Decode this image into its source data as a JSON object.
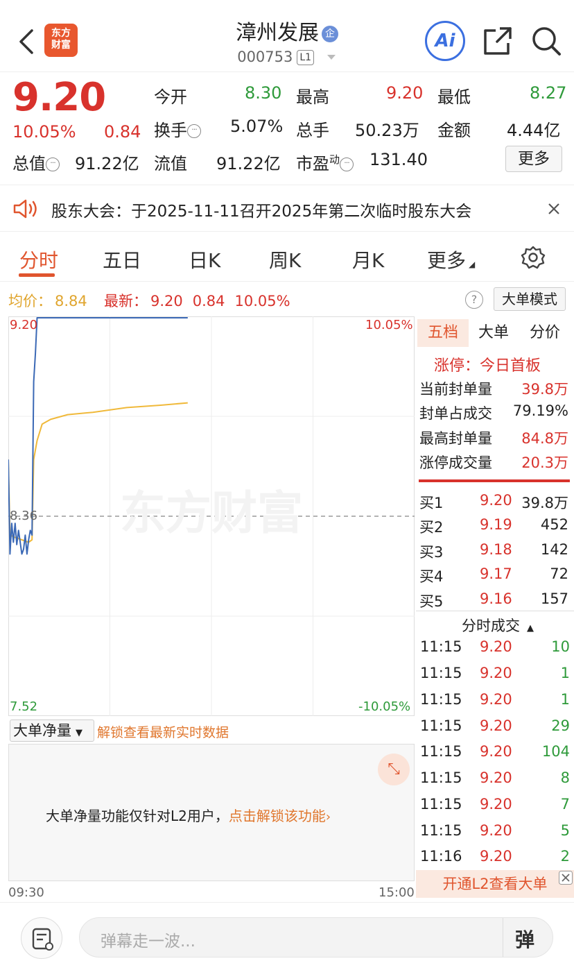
{
  "header": {
    "title": "漳州发展",
    "ent_badge": "企",
    "code": "000753",
    "level": "L1",
    "logo_text_1": "东方",
    "logo_text_2": "财富",
    "ai_label": "Ai"
  },
  "quote": {
    "price": "9.20",
    "change_pct": "10.05%",
    "change": "0.84",
    "open_label": "今开",
    "open": "8.30",
    "high_label": "最高",
    "high": "9.20",
    "low_label": "最低",
    "low": "8.27",
    "turnover_label": "换手",
    "turnover": "5.07%",
    "volume_label": "总手",
    "volume": "50.23万",
    "amount_label": "金额",
    "amount": "4.44亿",
    "mktcap_label": "总值",
    "mktcap": "91.22亿",
    "float_label": "流值",
    "float_cap": "91.22亿",
    "pe_label": "市盈",
    "pe_sup": "动",
    "pe": "131.40",
    "more_label": "更多"
  },
  "notice": {
    "text": "股东大会：于2025-11-11召开2025年第二次临时股东大会"
  },
  "tabs": {
    "items": [
      "分时",
      "五日",
      "日K",
      "周K",
      "月K",
      "更多"
    ],
    "active": 0
  },
  "chart_info": {
    "avg_label": "均价：",
    "avg": "8.84",
    "latest_label": "最新：",
    "latest": "9.20",
    "latest_change": "0.84",
    "latest_pct": "10.05%",
    "mode_button": "大单模式",
    "help": "?"
  },
  "chart_data": {
    "type": "line",
    "ylim": [
      7.52,
      9.2
    ],
    "ref_price": 8.36,
    "y_top_label": "9.20",
    "y_mid_label": "8.36",
    "y_bottom_label": "7.52",
    "pct_top_label": "10.05%",
    "pct_bottom_label": "-10.05%",
    "x_start_label": "09:30",
    "x_end_label": "15:00",
    "total_minutes": 240,
    "series": [
      {
        "color": "#3a68b5",
        "values": [
          [
            0,
            8.6
          ],
          [
            1,
            8.2
          ],
          [
            2,
            8.33
          ],
          [
            3,
            8.25
          ],
          [
            4,
            8.33
          ],
          [
            5,
            8.24
          ],
          [
            6,
            8.3
          ],
          [
            8,
            8.2
          ],
          [
            9,
            8.22
          ],
          [
            10,
            8.28
          ],
          [
            11,
            8.2
          ],
          [
            12,
            8.26
          ],
          [
            13,
            8.3
          ],
          [
            14,
            8.28
          ],
          [
            15,
            8.93
          ],
          [
            16,
            9.05
          ],
          [
            17,
            9.2
          ],
          [
            20,
            9.2
          ],
          [
            106,
            9.2
          ]
        ]
      },
      {
        "color": "#f0b93a",
        "values": [
          [
            0,
            8.6
          ],
          [
            1,
            8.28
          ],
          [
            4,
            8.27
          ],
          [
            8,
            8.26
          ],
          [
            12,
            8.25
          ],
          [
            14,
            8.26
          ],
          [
            15,
            8.6
          ],
          [
            17,
            8.68
          ],
          [
            20,
            8.75
          ],
          [
            25,
            8.77
          ],
          [
            35,
            8.79
          ],
          [
            50,
            8.8
          ],
          [
            70,
            8.82
          ],
          [
            90,
            8.83
          ],
          [
            106,
            8.84
          ]
        ]
      }
    ]
  },
  "panel": {
    "tabs": [
      "五档",
      "大单",
      "分价"
    ],
    "limit_up_label": "涨停：今日首板",
    "stats": [
      {
        "label": "当前封单量",
        "value": "39.8万"
      },
      {
        "label": "封单占成交",
        "value": "79.19%"
      },
      {
        "label": "最高封单量",
        "value": "84.8万"
      },
      {
        "label": "涨停成交量",
        "value": "20.3万"
      }
    ],
    "bids": [
      {
        "label": "买1",
        "price": "9.20",
        "vol": "39.8万"
      },
      {
        "label": "买2",
        "price": "9.19",
        "vol": "452"
      },
      {
        "label": "买3",
        "price": "9.18",
        "vol": "142"
      },
      {
        "label": "买4",
        "price": "9.17",
        "vol": "72"
      },
      {
        "label": "买5",
        "price": "9.16",
        "vol": "157"
      }
    ],
    "ticks_title": "分时成交",
    "ticks": [
      {
        "time": "11:15",
        "price": "9.20",
        "vol": "10"
      },
      {
        "time": "11:15",
        "price": "9.20",
        "vol": "1"
      },
      {
        "time": "11:15",
        "price": "9.20",
        "vol": "1"
      },
      {
        "time": "11:15",
        "price": "9.20",
        "vol": "29"
      },
      {
        "time": "11:15",
        "price": "9.20",
        "vol": "104"
      },
      {
        "time": "11:15",
        "price": "9.20",
        "vol": "8"
      },
      {
        "time": "11:15",
        "price": "9.20",
        "vol": "7"
      },
      {
        "time": "11:15",
        "price": "9.20",
        "vol": "5"
      },
      {
        "time": "11:16",
        "price": "9.20",
        "vol": "2"
      }
    ],
    "l2_bar": "开通L2查看大单"
  },
  "netvol": {
    "select_label": "大单净量",
    "unlock_link": "解锁查看最新实时数据",
    "message": "大单净量功能仅针对L2用户，",
    "unlock_action": "点击解锁该功能",
    "watermark": "东方财富"
  },
  "footer": {
    "placeholder": "弹幕走一波...",
    "danmu_label": "弹"
  }
}
